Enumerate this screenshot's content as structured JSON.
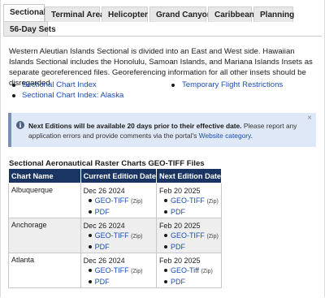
{
  "tabs": [
    "Sectional",
    "Terminal Area",
    "Helicopter",
    "Grand Canyon",
    "Caribbean",
    "Planning",
    "56-Day Sets"
  ],
  "active_tab": "Sectional",
  "intro_text": "Western Aleutian Islands Sectional is divided into an East and West side. Hawaiian Islands Sectional includes the Honolulu, Samoan Islands, and Mariana Islands Insets as separate georeferenced files. Georeferencing information for all other insets should be disregarded.",
  "links": {
    "sectional_index": "Sectional Chart Index",
    "sectional_index_alaska": "Sectional Chart Index: Alaska",
    "temporary_restrictions": "Temporary Flight Restrictions"
  },
  "alert": {
    "icon": "info-icon",
    "bold": "Next Editions will be available 20 days prior to their effective date.",
    "text": " Please report any application errors and provide comments via the portal's ",
    "link": "Website category",
    "end": ".",
    "close": "×"
  },
  "section_title": "Sectional Aeronautical Raster Charts GEO-TIFF Files",
  "table": {
    "headers": [
      "Chart Name",
      "Current Edition Date",
      "Next Edition Date"
    ],
    "zip_label": "(Zip)",
    "rows": [
      {
        "name": "Albuquerque",
        "current": "Dec 26 2024",
        "next": "Feb 20 2025",
        "cur_geo": "GEO-TIFF",
        "next_geo": "GEO-TIFF",
        "pdf": "PDF"
      },
      {
        "name": "Anchorage",
        "current": "Dec 26 2024",
        "next": "Feb 20 2025",
        "cur_geo": "GEO-TIFF",
        "next_geo": "GEO-TIFF",
        "pdf": "PDF"
      },
      {
        "name": "Atlanta",
        "current": "Dec 26 2024",
        "next": "Feb 20 2025",
        "cur_geo": "GEO-TIFF",
        "next_geo": "GEO-Tiff",
        "pdf": "PDF"
      }
    ]
  }
}
